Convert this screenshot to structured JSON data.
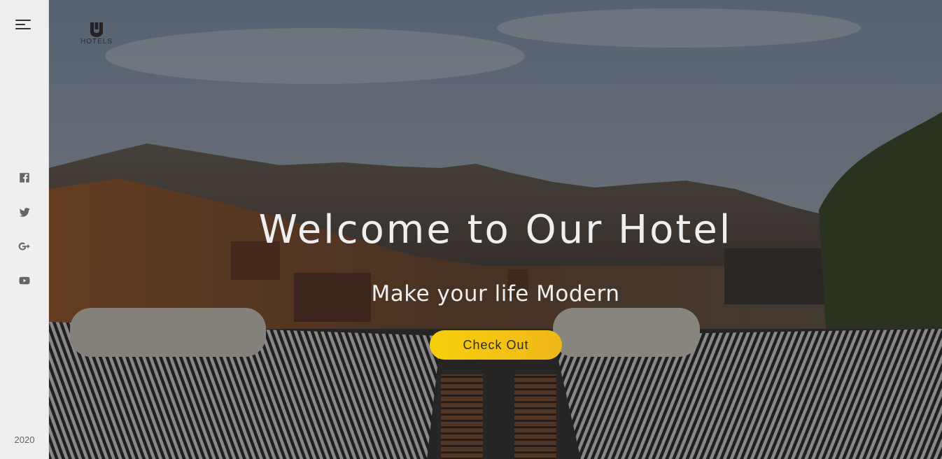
{
  "sidebar": {
    "menu_icon": "hamburger-menu-icon",
    "socials": [
      {
        "name": "facebook",
        "icon": "facebook-icon"
      },
      {
        "name": "twitter",
        "icon": "twitter-icon"
      },
      {
        "name": "google-plus",
        "icon": "google-plus-icon"
      },
      {
        "name": "youtube",
        "icon": "youtube-icon"
      }
    ],
    "year": "2020"
  },
  "brand": {
    "logo_text": "HOTELS"
  },
  "hero": {
    "headline": "Welcome to Our Hotel",
    "subline": "Make your life Modern",
    "cta_label": "Check Out",
    "cta_color": "#f5c518"
  }
}
